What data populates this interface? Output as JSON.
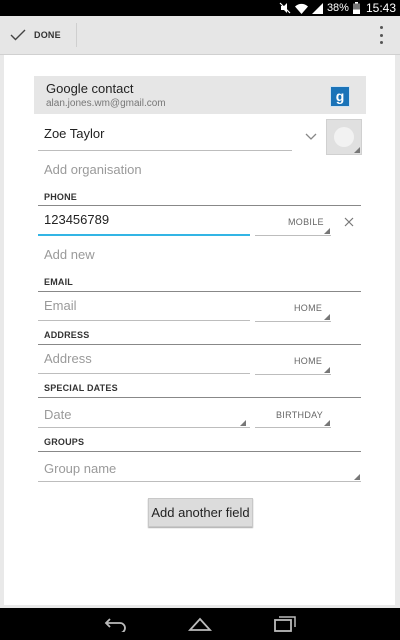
{
  "status": {
    "battery": "38%",
    "time": "15:43"
  },
  "actionbar": {
    "done_label": "DONE"
  },
  "account": {
    "type": "Google contact",
    "email": "alan.jones.wm@gmail.com",
    "logo": "g"
  },
  "name": {
    "value": "Zoe Taylor"
  },
  "organisation": {
    "placeholder": "Add organisation"
  },
  "phone": {
    "header": "PHONE",
    "value": "123456789",
    "type": "MOBILE",
    "add_new": "Add new"
  },
  "email": {
    "header": "EMAIL",
    "placeholder": "Email",
    "type": "HOME"
  },
  "address": {
    "header": "ADDRESS",
    "placeholder": "Address",
    "type": "HOME"
  },
  "dates": {
    "header": "SPECIAL DATES",
    "placeholder": "Date",
    "type": "BIRTHDAY"
  },
  "groups": {
    "header": "GROUPS",
    "placeholder": "Group name"
  },
  "add_field_button": "Add another field",
  "colors": {
    "accent": "#33b5e5",
    "google_blue": "#1a73b8"
  }
}
